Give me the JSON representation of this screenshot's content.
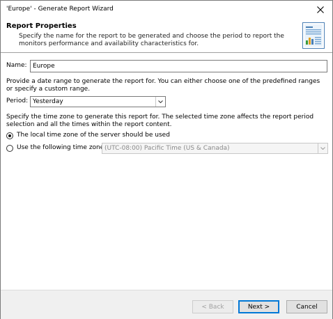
{
  "window": {
    "title": "'Europe' - Generate Report Wizard"
  },
  "header": {
    "title": "Report Properties",
    "description": "Specify the name for the report to be generated and choose the period to report the monitors performance and availability characteristics for."
  },
  "form": {
    "name_label": "Name:",
    "name_value": "Europe",
    "date_range_description": "Provide a date range to generate the report for. You can either choose one of the predefined ranges or specify a custom range.",
    "period_label": "Period:",
    "period_value": "Yesterday",
    "time_zone_description": "Specify the time zone to generate this report for. The selected time zone affects the report period selection and all the times within the report content.",
    "radio_local_label": "The local time zone of the server should be used",
    "radio_local_checked": true,
    "radio_custom_label": "Use the following time zone:",
    "radio_custom_checked": false,
    "time_zone_value": "(UTC-08:00) Pacific Time (US & Canada)"
  },
  "footer": {
    "back_label": "< Back",
    "next_label": "Next >",
    "cancel_label": "Cancel"
  },
  "colors": {
    "accent": "#0078d7",
    "footer_bg": "#f0f0f0"
  },
  "icons": {
    "close": "close-icon",
    "report": "report-icon",
    "dropdown": "chevron-down-icon"
  }
}
